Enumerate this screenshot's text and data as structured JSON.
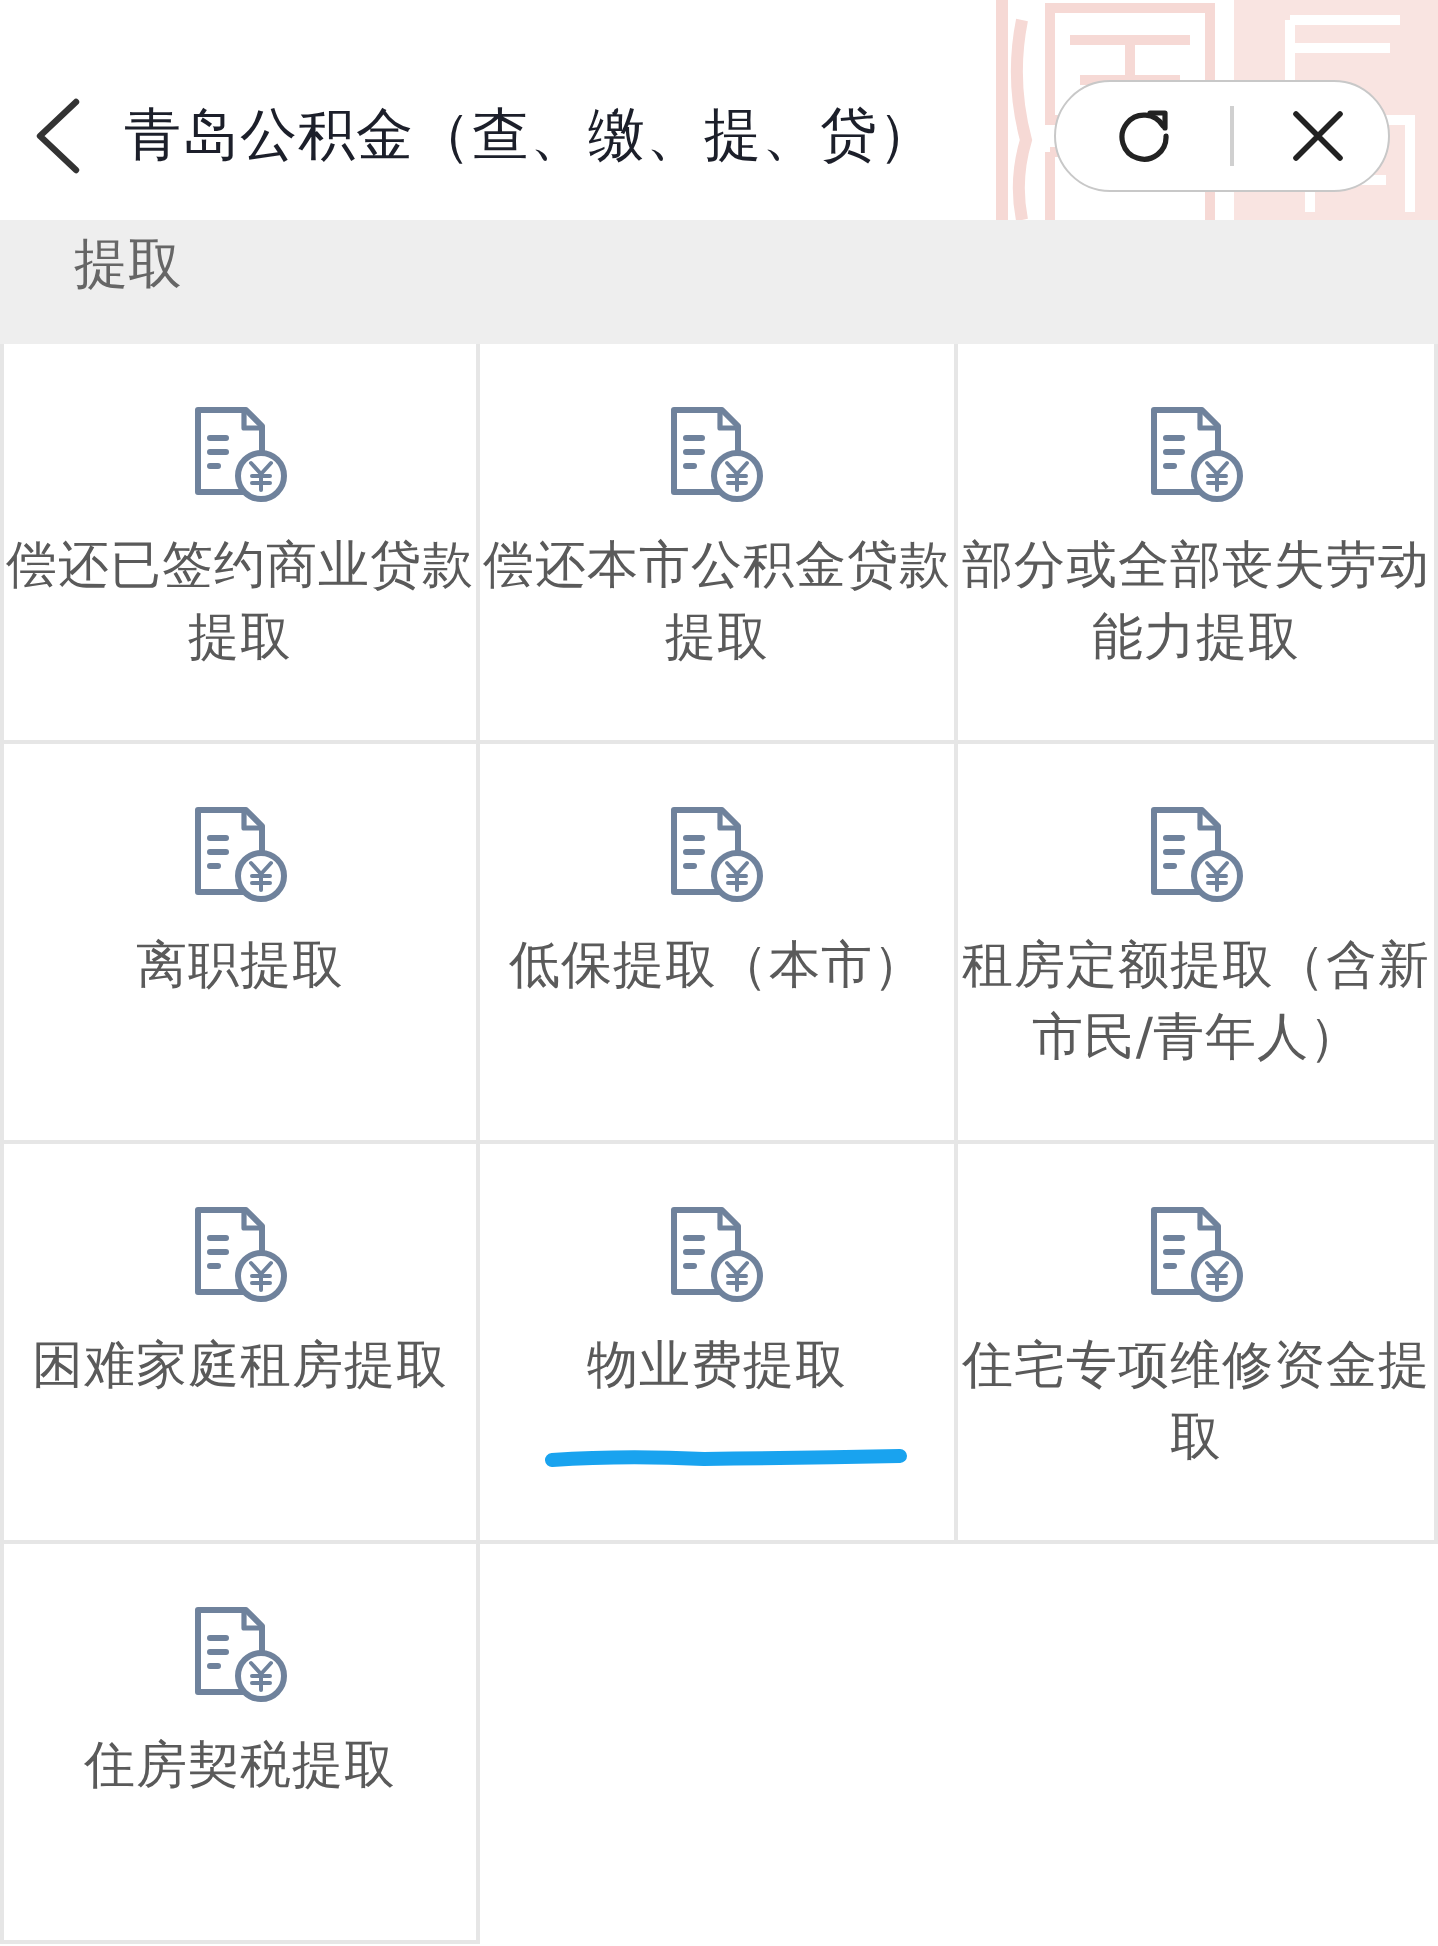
{
  "header": {
    "title": "青岛公积金（查、缴、提、贷）"
  },
  "section": {
    "title": "提取"
  },
  "items": [
    {
      "label": "偿还已签约商业贷款提取",
      "underlined": false
    },
    {
      "label": "偿还本市公积金贷款提取",
      "underlined": false
    },
    {
      "label": "部分或全部丧失劳动能力提取",
      "underlined": false
    },
    {
      "label": "离职提取",
      "underlined": false
    },
    {
      "label": "低保提取（本市）",
      "underlined": false
    },
    {
      "label": "租房定额提取（含新市民/青年人）",
      "underlined": false
    },
    {
      "label": "困难家庭租房提取",
      "underlined": false
    },
    {
      "label": "物业费提取",
      "underlined": true
    },
    {
      "label": "住宅专项维修资金提取",
      "underlined": false
    },
    {
      "label": "住房契税提取",
      "underlined": false
    }
  ]
}
